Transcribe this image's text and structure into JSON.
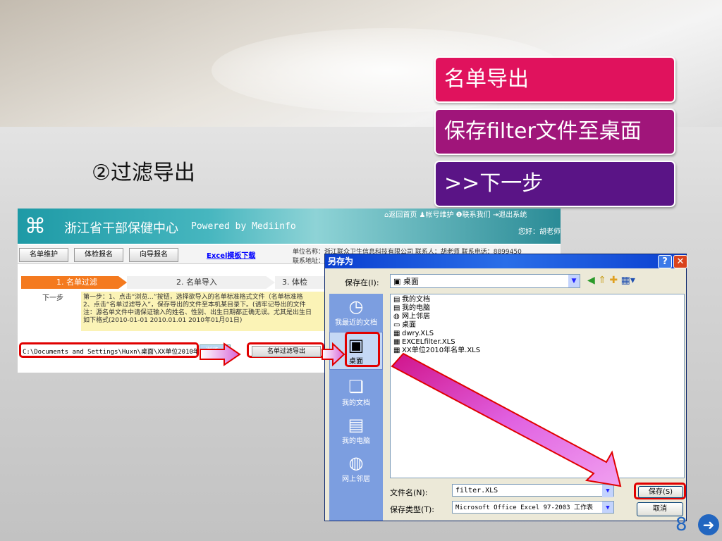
{
  "steps": {
    "step1": "名单导出",
    "step2": "保存filter文件至桌面",
    "step3": ">>下一步"
  },
  "subtitle": "②过滤导出",
  "web": {
    "logo_text": "浙江省干部保健中心",
    "powered_by": "Powered by Mediinfo",
    "top_links": "⌂返回首页  ♟帐号维护  ❶联系我们  ⇥退出系统",
    "hello": "您好：胡老师",
    "tabs": [
      "名单维护",
      "体检报名",
      "向导报名"
    ],
    "excel_link": "Excel模板下载",
    "unit_line1": "单位名称：浙江联众卫生信息科技有限公司   联系人：胡老师   联系电话：8899450",
    "unit_line2": "联系地址：",
    "step_bar": [
      "1. 名单过滤",
      "2. 名单导入",
      "3. 体检"
    ],
    "next_label": "下一步",
    "instructions": [
      "第一步：1、点击“浏览...”按钮，选择欲导入的名单标准格式文件（名单标准格",
      "2、点击“名单过滤导入”，保存导出的文件至本机某目录下。(请牢记导出的文件",
      "注：源名单文件中请保证输入的姓名、性别、出生日期都正确无误。尤其是出生日",
      "如下格式(2010-01-01 2010.01.01 2010年01月01日)"
    ],
    "path_value": "C:\\Documents and Settings\\Huxn\\桌面\\XX单位2010年名单.",
    "browse_label": "浏览...",
    "filter_button": "名单过滤导出"
  },
  "dialog": {
    "title": "另存为",
    "help": "?",
    "close": "✕",
    "save_in_label": "保存在(I):",
    "save_in_value": "桌面",
    "places": [
      "我最近的文档",
      "桌面",
      "我的文档",
      "我的电脑",
      "网上邻居"
    ],
    "files": [
      "我的文档",
      "我的电脑",
      "网上邻居",
      "桌面",
      "dwry.XLS",
      "EXCELfilter.XLS",
      "XX单位2010年名单.XLS"
    ],
    "filename_label": "文件名(N):",
    "filename_value": "filter.XLS",
    "filetype_label": "保存类型(T):",
    "filetype_value": "Microsoft Office Excel 97-2003 工作表",
    "save_button": "保存(S)",
    "cancel_button": "取消"
  },
  "page_number": "8",
  "next_icon": "arrow-right-circle-icon"
}
